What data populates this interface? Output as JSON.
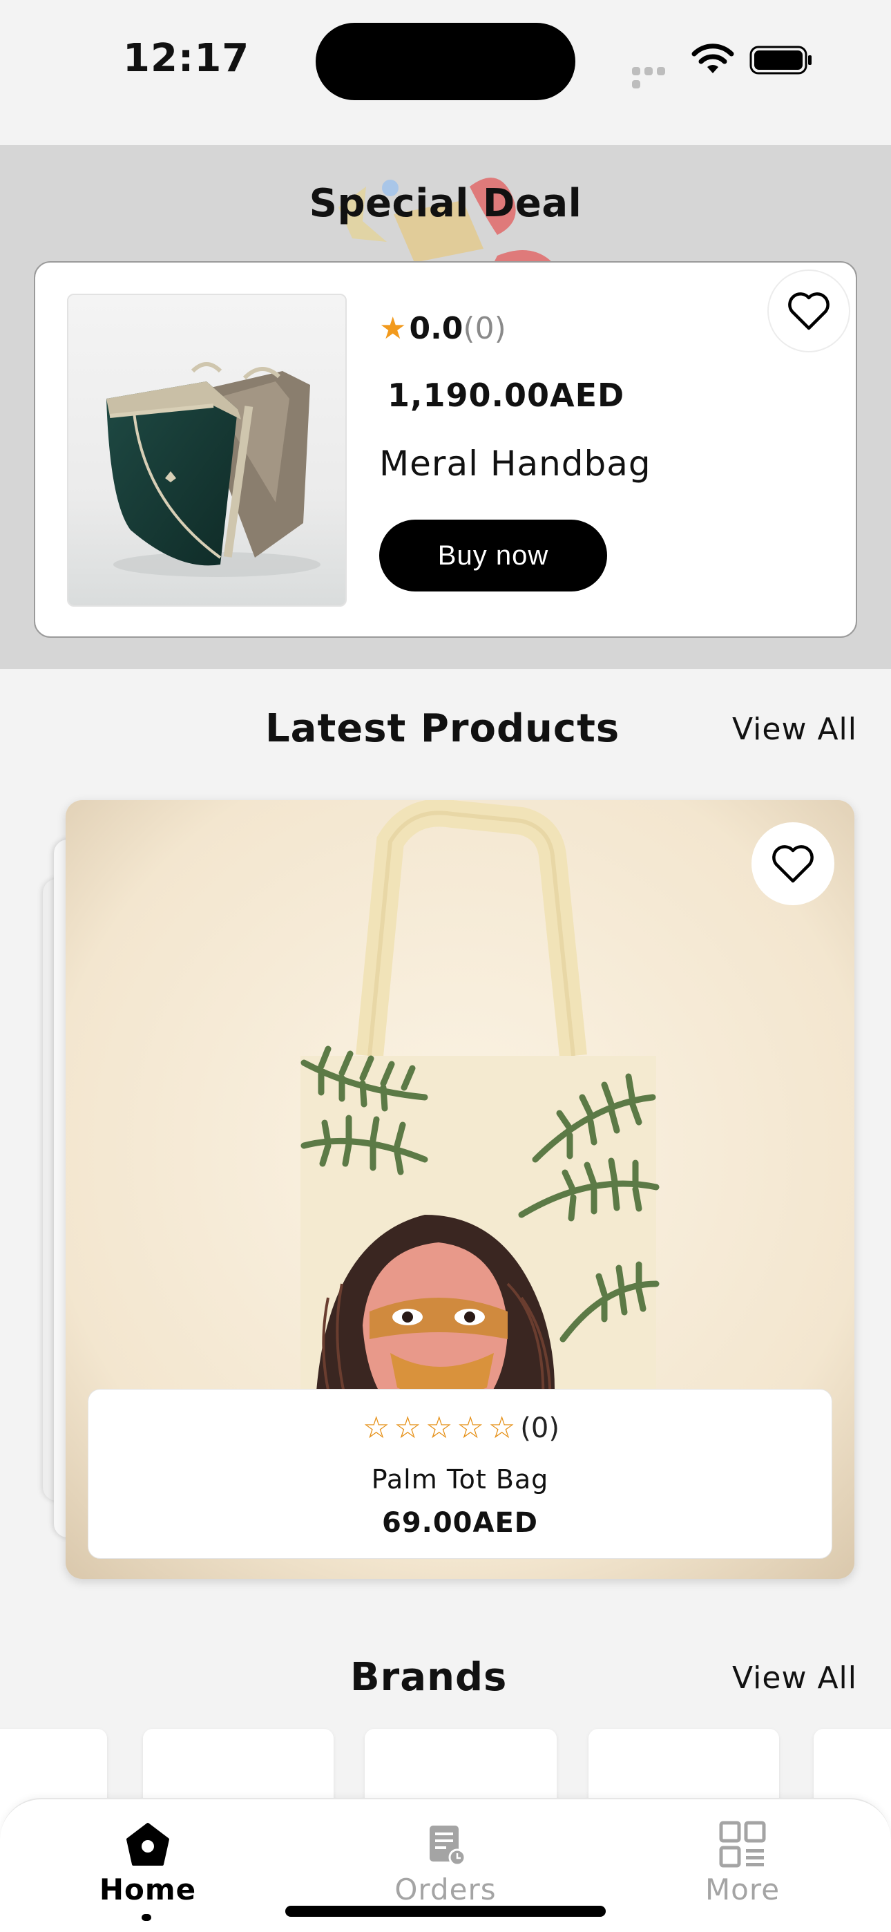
{
  "status_bar": {
    "time": "12:17"
  },
  "special_deal": {
    "title": "Special Deal",
    "product": {
      "rating_score": "0.0",
      "rating_count": "(0)",
      "price": "1,190.00AED",
      "name": "Meral Handbag",
      "buy_label": "Buy now"
    }
  },
  "latest_products": {
    "title": "Latest Products",
    "view_all_label": "View All",
    "items": [
      {
        "rating_count": "(0)",
        "stars_filled": 0,
        "stars_total": 5,
        "name": "Palm Tot Bag",
        "price": "69.00AED"
      }
    ]
  },
  "brands": {
    "title": "Brands",
    "view_all_label": "View All"
  },
  "tab_bar": {
    "tabs": [
      {
        "label": "Home",
        "icon": "home-icon",
        "active": true
      },
      {
        "label": "Orders",
        "icon": "orders-icon",
        "active": false
      },
      {
        "label": "More",
        "icon": "grid-icon",
        "active": false
      }
    ]
  },
  "colors": {
    "accent_star": "#f29a1d",
    "button_bg": "#000000",
    "deal_background": "#d6d6d6",
    "page_background": "#f3f3f3"
  }
}
